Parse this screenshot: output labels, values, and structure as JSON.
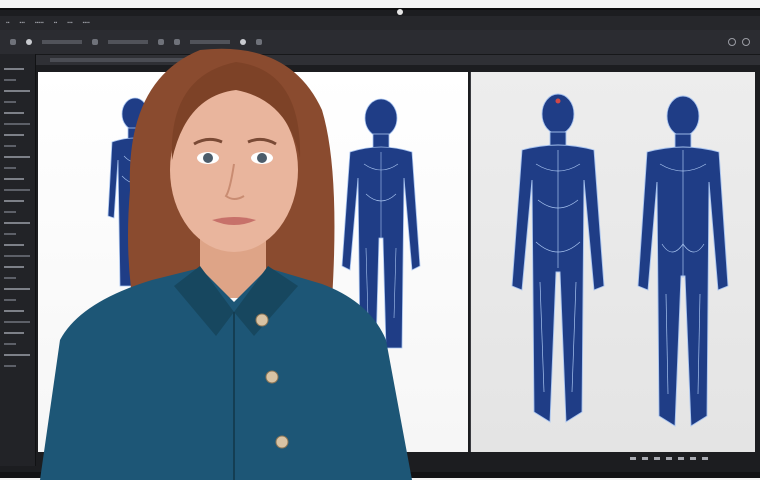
{
  "scene": {
    "background": "#f3f3f3",
    "monitor_color": "#1c1d20",
    "figure_color": "#1f3d86",
    "figure_line_color": "#a8c4f0",
    "shirt_color": "#1d5676",
    "hair_color": "#8a4b2f",
    "skin_color": "#e9b59d"
  },
  "icons": {
    "camera": "camera-icon",
    "buttons": "shirt-button-icon"
  }
}
